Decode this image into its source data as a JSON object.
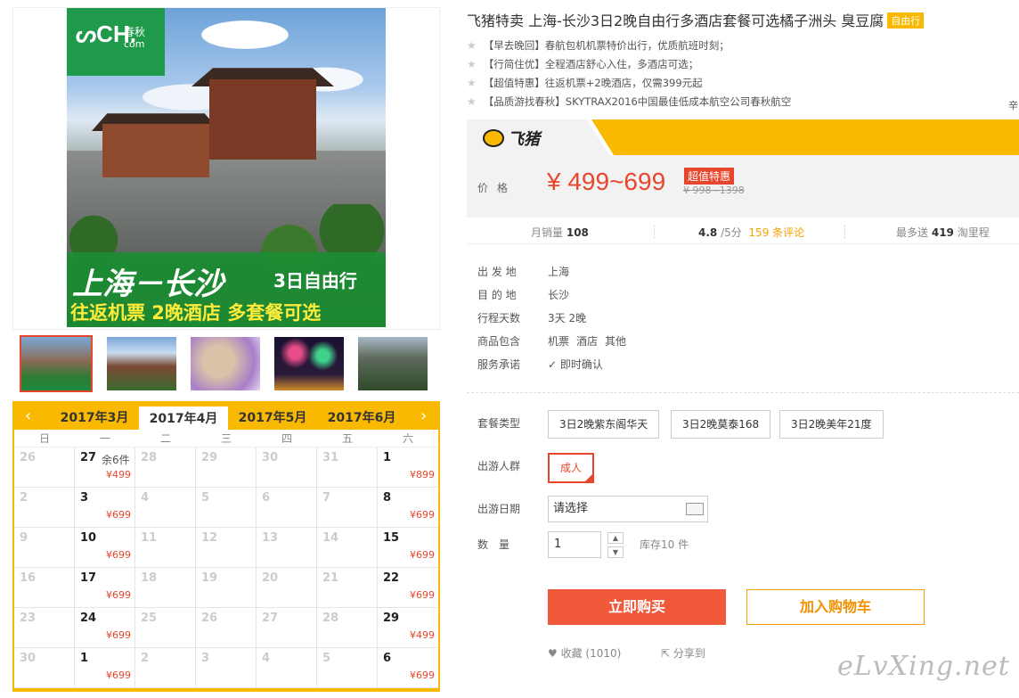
{
  "gallery": {
    "logo_main": "ᔕCH.",
    "logo_cn": "春秋",
    "logo_com": "com",
    "banner_route": "上海－长沙",
    "banner_tour": "3日自由行",
    "banner_sub": "往返机票 2晚酒店 多套餐可选"
  },
  "calendar": {
    "prev": "‹",
    "next": "›",
    "months": [
      "2017年3月",
      "2017年4月",
      "2017年5月",
      "2017年6月"
    ],
    "weekdays": [
      "日",
      "一",
      "二",
      "三",
      "四",
      "五",
      "六"
    ],
    "cells": [
      {
        "d": "26",
        "p": "",
        "n": "",
        "on": false
      },
      {
        "d": "27",
        "p": "¥499",
        "n": "余6件",
        "on": true
      },
      {
        "d": "28",
        "p": "",
        "n": "",
        "on": false
      },
      {
        "d": "29",
        "p": "",
        "n": "",
        "on": false
      },
      {
        "d": "30",
        "p": "",
        "n": "",
        "on": false
      },
      {
        "d": "31",
        "p": "",
        "n": "",
        "on": false
      },
      {
        "d": "1",
        "p": "¥899",
        "n": "",
        "on": true
      },
      {
        "d": "2",
        "p": "",
        "n": "",
        "on": false
      },
      {
        "d": "3",
        "p": "¥699",
        "n": "",
        "on": true
      },
      {
        "d": "4",
        "p": "",
        "n": "",
        "on": false
      },
      {
        "d": "5",
        "p": "",
        "n": "",
        "on": false
      },
      {
        "d": "6",
        "p": "",
        "n": "",
        "on": false
      },
      {
        "d": "7",
        "p": "",
        "n": "",
        "on": false
      },
      {
        "d": "8",
        "p": "¥699",
        "n": "",
        "on": true
      },
      {
        "d": "9",
        "p": "",
        "n": "",
        "on": false
      },
      {
        "d": "10",
        "p": "¥699",
        "n": "",
        "on": true
      },
      {
        "d": "11",
        "p": "",
        "n": "",
        "on": false
      },
      {
        "d": "12",
        "p": "",
        "n": "",
        "on": false
      },
      {
        "d": "13",
        "p": "",
        "n": "",
        "on": false
      },
      {
        "d": "14",
        "p": "",
        "n": "",
        "on": false
      },
      {
        "d": "15",
        "p": "¥699",
        "n": "",
        "on": true
      },
      {
        "d": "16",
        "p": "",
        "n": "",
        "on": false
      },
      {
        "d": "17",
        "p": "¥699",
        "n": "",
        "on": true
      },
      {
        "d": "18",
        "p": "",
        "n": "",
        "on": false
      },
      {
        "d": "19",
        "p": "",
        "n": "",
        "on": false
      },
      {
        "d": "20",
        "p": "",
        "n": "",
        "on": false
      },
      {
        "d": "21",
        "p": "",
        "n": "",
        "on": false
      },
      {
        "d": "22",
        "p": "¥699",
        "n": "",
        "on": true
      },
      {
        "d": "23",
        "p": "",
        "n": "",
        "on": false
      },
      {
        "d": "24",
        "p": "¥699",
        "n": "",
        "on": true
      },
      {
        "d": "25",
        "p": "",
        "n": "",
        "on": false
      },
      {
        "d": "26",
        "p": "",
        "n": "",
        "on": false
      },
      {
        "d": "27",
        "p": "",
        "n": "",
        "on": false
      },
      {
        "d": "28",
        "p": "",
        "n": "",
        "on": false
      },
      {
        "d": "29",
        "p": "¥499",
        "n": "",
        "on": true
      },
      {
        "d": "30",
        "p": "",
        "n": "",
        "on": false
      },
      {
        "d": "1",
        "p": "¥699",
        "n": "",
        "on": true
      },
      {
        "d": "2",
        "p": "",
        "n": "",
        "on": false
      },
      {
        "d": "3",
        "p": "",
        "n": "",
        "on": false
      },
      {
        "d": "4",
        "p": "",
        "n": "",
        "on": false
      },
      {
        "d": "5",
        "p": "",
        "n": "",
        "on": false
      },
      {
        "d": "6",
        "p": "¥699",
        "n": "",
        "on": true
      }
    ]
  },
  "product": {
    "title": "飞猪特卖 上海-长沙3日2晚自由行多酒店套餐可选橘子洲头 臭豆腐",
    "badge": "自由行",
    "features": [
      "【早去晚回】春航包机机票特价出行，优质航班时刻；",
      "【行简住优】全程酒店舒心入住，多酒店可选；",
      "【超值特惠】往返机票+2晚酒店，仅需399元起",
      "【品质游找春秋】SKYTRAX2016中国最佳低成本航空公司春秋航空"
    ],
    "side_char": "辛",
    "brand": "飞猪",
    "price_label": "价格",
    "price": "¥ 499~699",
    "price_tag": "超值特惠",
    "price_old": "¥ 998~1398"
  },
  "stats": {
    "sales_label": "月销量",
    "sales": "108",
    "rating": "4.8",
    "rating_unit": "/5分",
    "reviews": "159 条评论",
    "miles_label": "最多送",
    "miles": "419",
    "miles_unit": "淘里程"
  },
  "info": [
    {
      "k": "出 发 地",
      "v": [
        "上海"
      ]
    },
    {
      "k": "目 的 地",
      "v": [
        "长沙"
      ]
    },
    {
      "k": "行程天数",
      "v": [
        "3天 2晚"
      ]
    },
    {
      "k": "商品包含",
      "v": [
        "机票",
        "酒店",
        "其他"
      ]
    },
    {
      "k": "服务承诺",
      "v": [
        "✓ 即时确认"
      ]
    }
  ],
  "options": {
    "pkg_label": "套餐类型",
    "packages": [
      "3日2晚紫东阁华天",
      "3日2晚莫泰168",
      "3日2晚美年21度"
    ],
    "crowd_label": "出游人群",
    "crowd": "成人",
    "date_label": "出游日期",
    "date_value": "请选择",
    "qty_label": "数　量",
    "qty_value": "1",
    "stock": "库存10 件"
  },
  "actions": {
    "buy": "立即购买",
    "cart": "加入购物车",
    "fav": "收藏 (1010)",
    "share": "分享到"
  },
  "watermark": "eLvXing.net"
}
